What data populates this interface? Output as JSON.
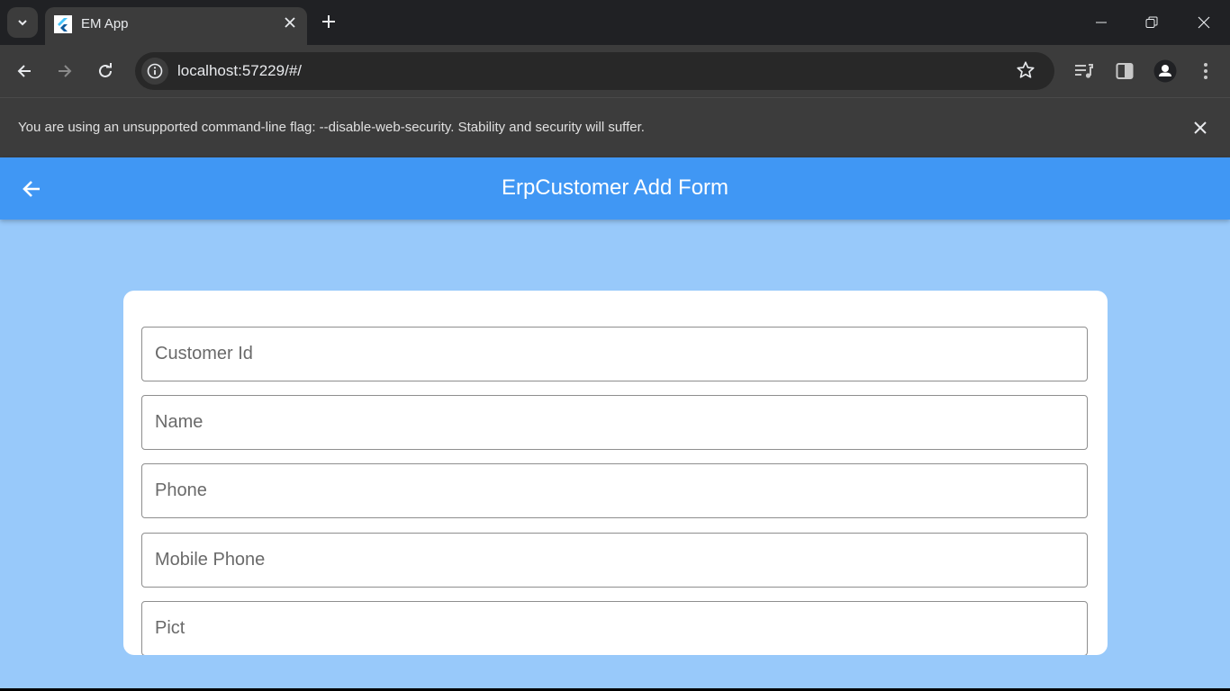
{
  "browser": {
    "tab": {
      "title": "EM App"
    },
    "address_bar": {
      "url": "localhost:57229/#/"
    },
    "infobar": {
      "message": "You are using an unsupported command-line flag: --disable-web-security. Stability and security will suffer."
    }
  },
  "app": {
    "appbar": {
      "title": "ErpCustomer Add Form"
    },
    "colors": {
      "appbar": "#4097f4",
      "background": "#98c9fa",
      "card": "#ffffff"
    },
    "form": {
      "fields": [
        {
          "name": "customer-id",
          "placeholder": "Customer Id",
          "value": ""
        },
        {
          "name": "name",
          "placeholder": "Name",
          "value": ""
        },
        {
          "name": "phone",
          "placeholder": "Phone",
          "value": ""
        },
        {
          "name": "mobile-phone",
          "placeholder": "Mobile Phone",
          "value": ""
        },
        {
          "name": "pict",
          "placeholder": "Pict",
          "value": ""
        }
      ]
    }
  }
}
